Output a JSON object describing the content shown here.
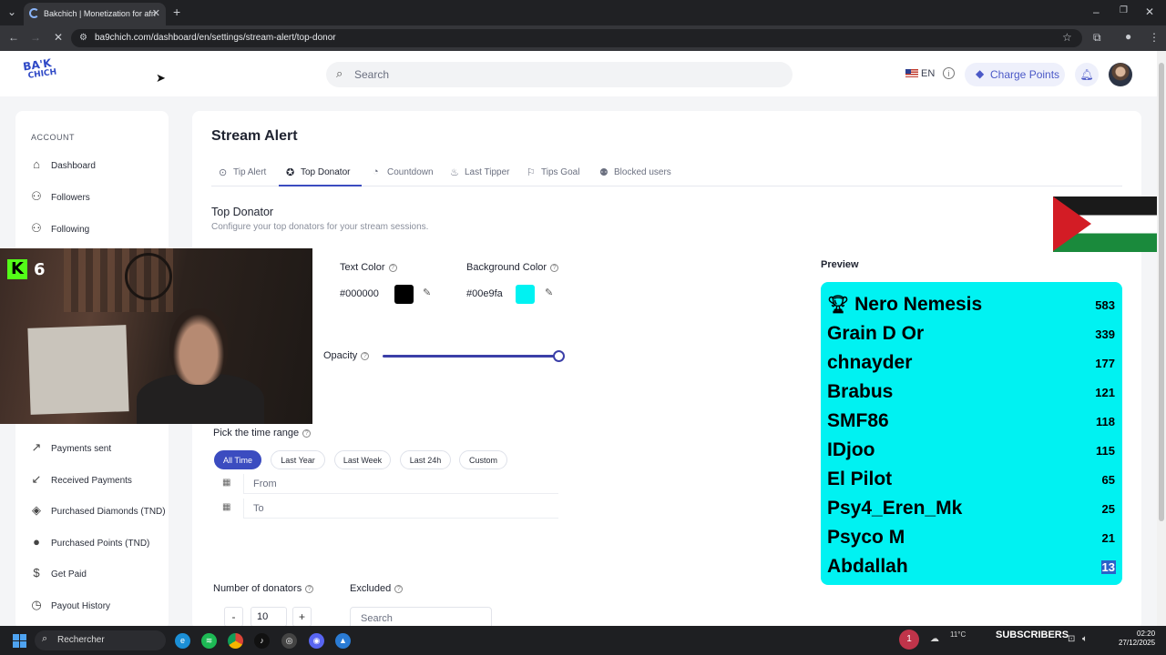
{
  "browser": {
    "tab_title": "Bakchich | Monetization for afri",
    "url": "ba9chich.com/dashboard/en/settings/stream-alert/top-donor"
  },
  "header": {
    "logo_line1": "BA'K",
    "logo_line2": "CHICH",
    "search_placeholder": "Search",
    "lang": "EN",
    "charge_points": "Charge Points"
  },
  "sidebar": {
    "section": "ACCOUNT",
    "items": [
      {
        "label": "Dashboard",
        "icon": "home-icon"
      },
      {
        "label": "Followers",
        "icon": "users-icon"
      },
      {
        "label": "Following",
        "icon": "users-icon"
      },
      {
        "label": "Payments sent",
        "icon": "arrow-up-right-icon"
      },
      {
        "label": "Received Payments",
        "icon": "arrow-down-left-icon"
      },
      {
        "label": "Purchased Diamonds (TND)",
        "icon": "diamond-icon"
      },
      {
        "label": "Purchased Points (TND)",
        "icon": "coin-icon"
      },
      {
        "label": "Get Paid",
        "icon": "dollar-icon"
      },
      {
        "label": "Payout History",
        "icon": "history-icon"
      }
    ]
  },
  "overlay": {
    "kick_logo": "K",
    "kick_viewers": "6"
  },
  "main": {
    "title": "Stream Alert",
    "tabs": [
      {
        "label": "Tip Alert",
        "icon": "tip-icon"
      },
      {
        "label": "Top Donator",
        "icon": "medal-icon",
        "active": true
      },
      {
        "label": "Countdown",
        "icon": "timer-icon"
      },
      {
        "label": "Last Tipper",
        "icon": "flame-icon"
      },
      {
        "label": "Tips Goal",
        "icon": "flag-icon"
      },
      {
        "label": "Blocked users",
        "icon": "user-block-icon"
      }
    ],
    "section_title": "Top Donator",
    "section_subtitle": "Configure your top donators for your stream sessions.",
    "text_color_label": "Text Color",
    "text_color_value": "#000000",
    "bg_color_label": "Background Color",
    "bg_color_value": "#00e9fa",
    "opacity_label": "Opacity",
    "opacity_value": 1.0,
    "time_range_label": "Pick the time range",
    "time_ranges": [
      "All Time",
      "Last Year",
      "Last Week",
      "Last 24h",
      "Custom"
    ],
    "active_range": "All Time",
    "from_placeholder": "From",
    "to_placeholder": "To",
    "num_donators_label": "Number of donators",
    "num_donators_value": "10",
    "stepper_minus": "-",
    "stepper_plus": "+",
    "excluded_label": "Excluded",
    "excluded_placeholder": "Search",
    "preview_label": "Preview",
    "preview_rows": [
      {
        "name": "Nero Nemesis",
        "score": "583"
      },
      {
        "name": "Grain D Or",
        "score": "339"
      },
      {
        "name": "chnayder",
        "score": "177"
      },
      {
        "name": "Brabus",
        "score": "121"
      },
      {
        "name": "SMF86",
        "score": "118"
      },
      {
        "name": "IDjoo",
        "score": "115"
      },
      {
        "name": "El Pilot",
        "score": "65"
      },
      {
        "name": "Psy4_Eren_Mk",
        "score": "25"
      },
      {
        "name": "Psyco M",
        "score": "21"
      },
      {
        "name": "Abdallah",
        "score": "13"
      }
    ]
  },
  "taskbar": {
    "search": "Rechercher",
    "notif_count": "1",
    "temp": "11°C",
    "subscribers": "SUBSCRIBERS",
    "time": "02:20",
    "date": "27/12/2025"
  },
  "colors": {
    "accent": "#3b4cc0",
    "preview_bg": "#00f2f2",
    "text_swatch": "#000000",
    "bg_swatch": "#00e9fa"
  }
}
